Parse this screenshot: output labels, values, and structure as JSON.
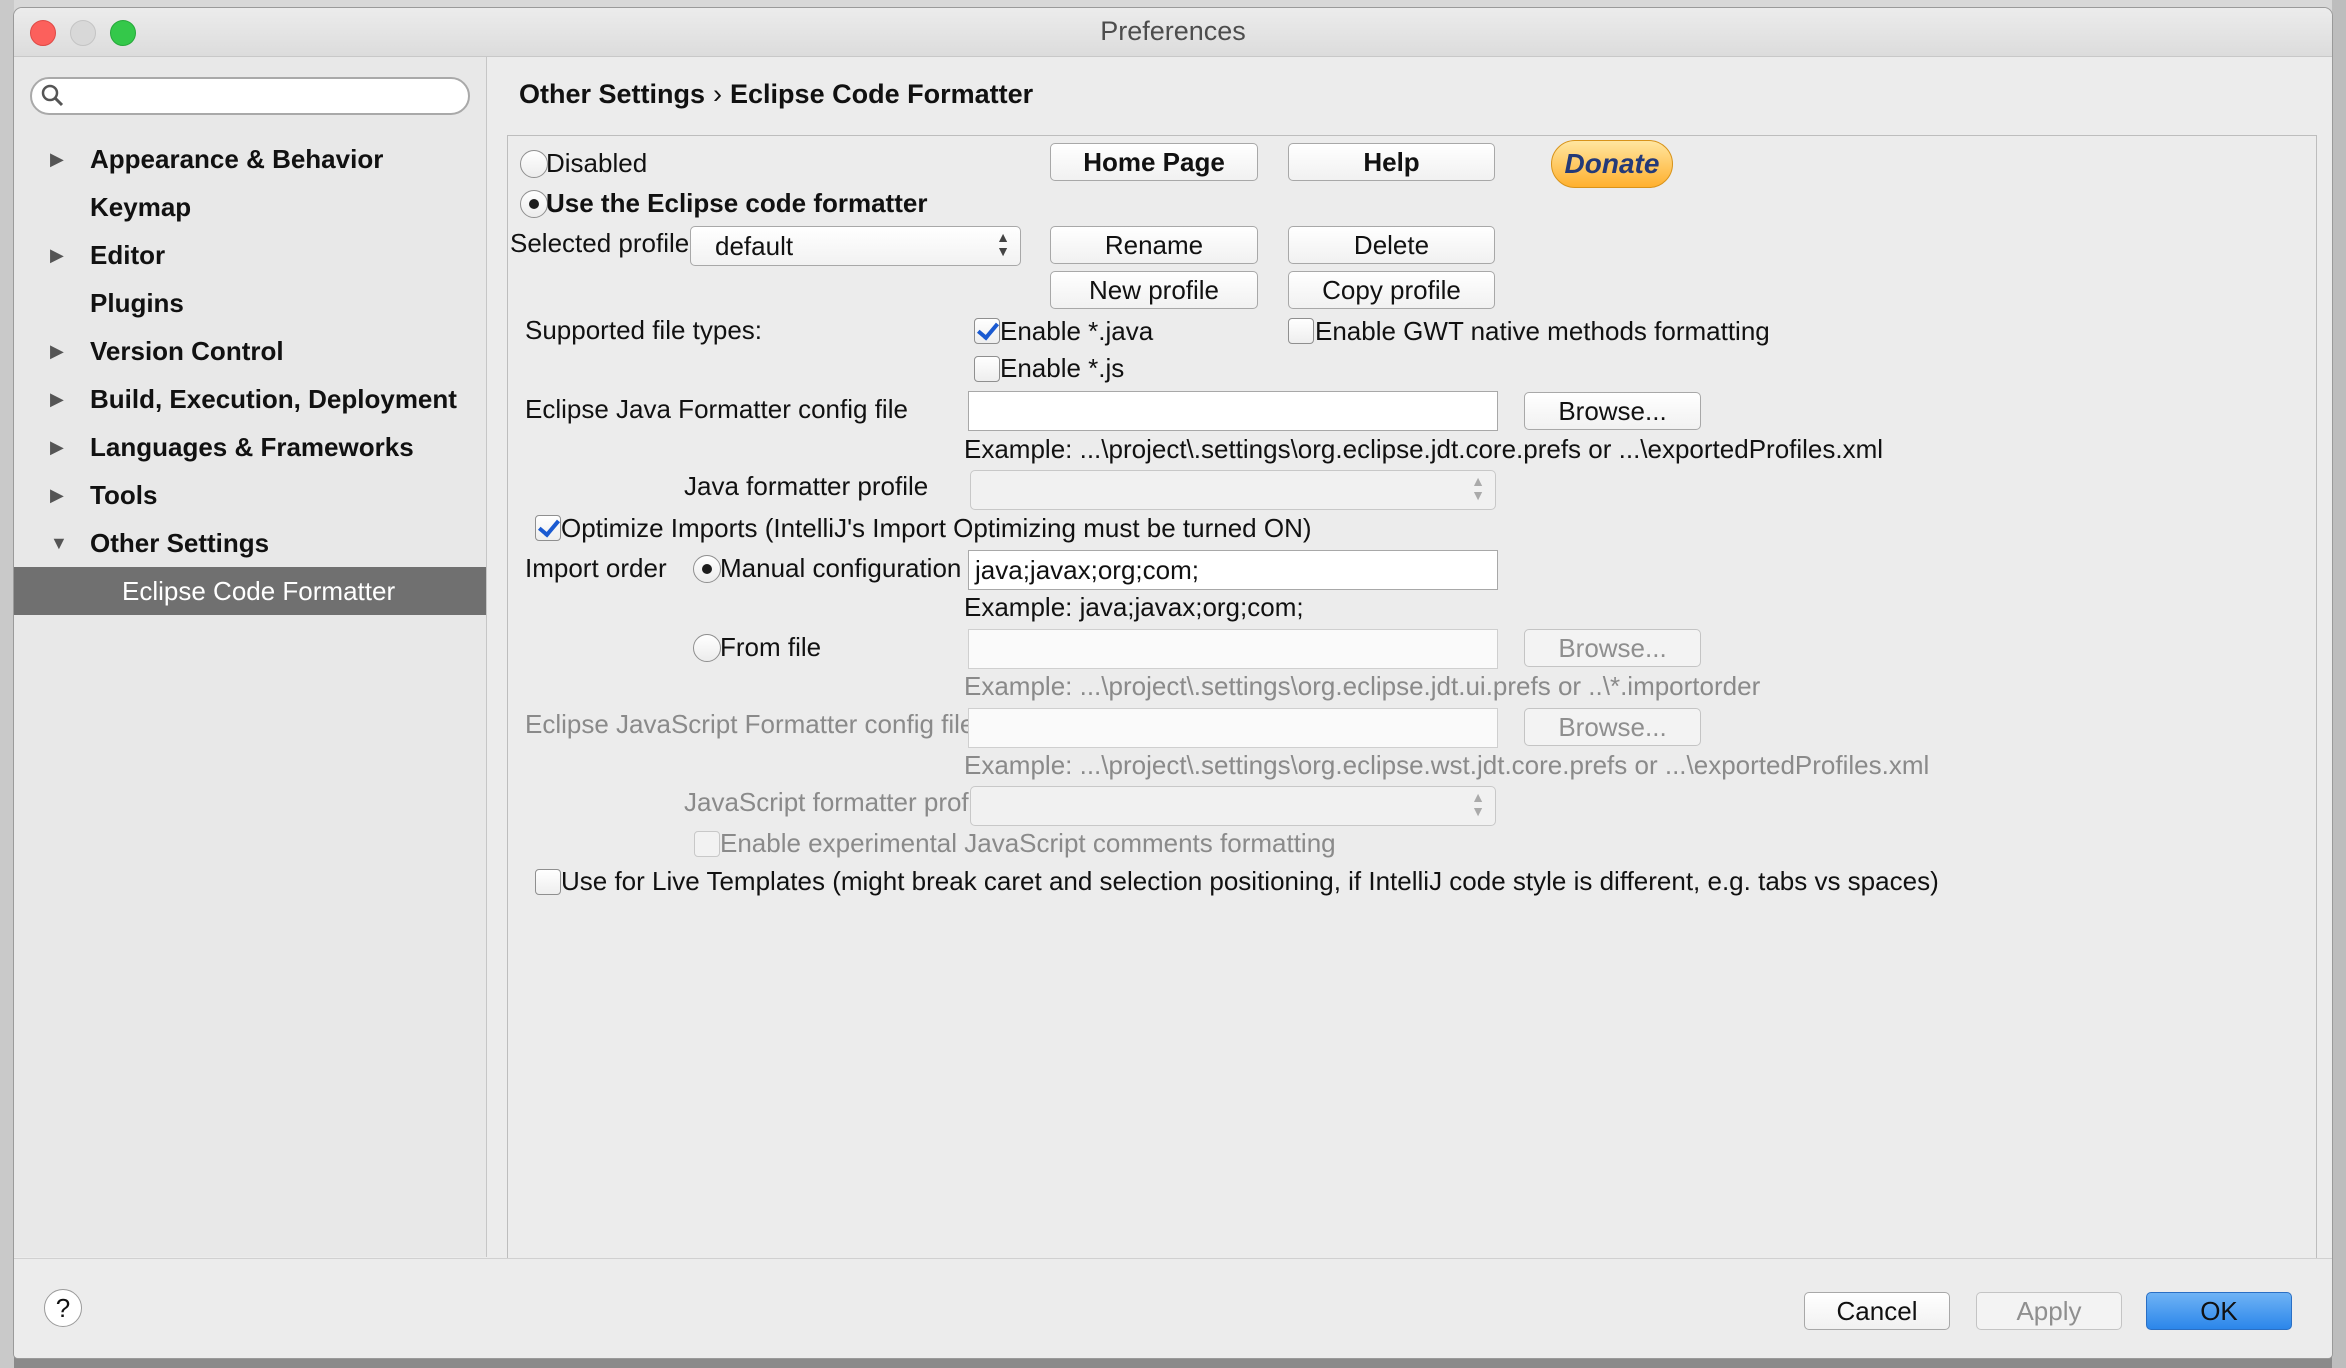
{
  "window": {
    "title": "Preferences"
  },
  "search": {
    "placeholder": ""
  },
  "sidebar": {
    "items": [
      {
        "label": "Appearance & Behavior",
        "arrow": "▶"
      },
      {
        "label": "Keymap",
        "arrow": ""
      },
      {
        "label": "Editor",
        "arrow": "▶"
      },
      {
        "label": "Plugins",
        "arrow": ""
      },
      {
        "label": "Version Control",
        "arrow": "▶"
      },
      {
        "label": "Build, Execution, Deployment",
        "arrow": "▶"
      },
      {
        "label": "Languages & Frameworks",
        "arrow": "▶"
      },
      {
        "label": "Tools",
        "arrow": "▶"
      },
      {
        "label": "Other Settings",
        "arrow": "▼"
      },
      {
        "label": "Eclipse Code Formatter",
        "arrow": ""
      }
    ]
  },
  "breadcrumb": {
    "parent": "Other Settings",
    "separator": "›",
    "current": "Eclipse Code Formatter"
  },
  "formatter": {
    "disabled_label": "Disabled",
    "use_eclipse_label": "Use the Eclipse code formatter",
    "home_page": "Home Page",
    "help": "Help",
    "donate": "Donate",
    "selected_profile_label": "Selected profile:",
    "selected_profile_value": "default",
    "rename": "Rename",
    "delete": "Delete",
    "new_profile": "New profile",
    "copy_profile": "Copy profile",
    "supported_types_label": "Supported file types:",
    "enable_java": "Enable *.java",
    "enable_gwt": "Enable GWT native methods formatting",
    "enable_js": "Enable *.js",
    "java_config_label": "Eclipse Java Formatter config file",
    "java_config_value": "",
    "browse": "Browse...",
    "java_config_example": "Example: ...\\project\\.settings\\org.eclipse.jdt.core.prefs or ...\\exportedProfiles.xml",
    "java_profile_label": "Java formatter profile",
    "optimize_imports": "Optimize Imports  (IntelliJ's Import Optimizing must be turned ON)",
    "import_order_label": "Import order",
    "manual_config": "Manual configuration",
    "import_order_value": "java;javax;org;com;",
    "import_order_example": "Example: java;javax;org;com;",
    "from_file": "From file",
    "from_file_value": "",
    "from_file_example": "Example: ...\\project\\.settings\\org.eclipse.jdt.ui.prefs or ..\\*.importorder",
    "js_config_label": "Eclipse JavaScript Formatter config file",
    "js_config_value": "",
    "js_config_example": "Example: ...\\project\\.settings\\org.eclipse.wst.jdt.core.prefs or ...\\exportedProfiles.xml",
    "js_profile_label": "JavaScript formatter profile",
    "js_comments": "Enable experimental JavaScript comments formatting",
    "live_templates": "Use for Live Templates (might break caret and selection positioning, if IntelliJ code style is different, e.g. tabs vs spaces)"
  },
  "state": {
    "disabled": false,
    "use_eclipse": true,
    "enable_java": true,
    "enable_gwt": false,
    "enable_js": false,
    "optimize_imports": true,
    "manual_config": true,
    "from_file": false,
    "js_comments": false,
    "live_templates": false
  },
  "footer": {
    "help": "?",
    "cancel": "Cancel",
    "apply": "Apply",
    "ok": "OK"
  },
  "colors": {
    "accent": "#2b86ea",
    "donate": "#ffb02e",
    "close": "#fc605c",
    "maximize": "#34c84a",
    "selection": "#707070"
  }
}
